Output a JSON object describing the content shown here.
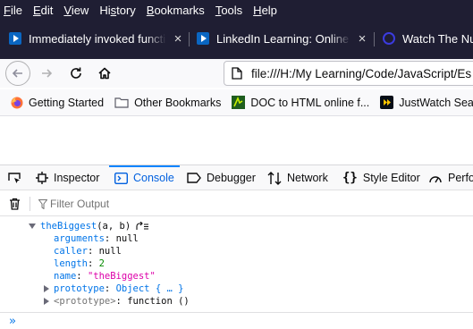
{
  "menubar": {
    "items": [
      {
        "accel": "F",
        "rest": "ile"
      },
      {
        "accel": "E",
        "rest": "dit"
      },
      {
        "accel": "V",
        "rest": "iew"
      },
      {
        "pre": "Hi",
        "accel": "s",
        "rest": "tory"
      },
      {
        "accel": "B",
        "rest": "ookmarks"
      },
      {
        "accel": "T",
        "rest": "ools"
      },
      {
        "accel": "H",
        "rest": "elp"
      }
    ]
  },
  "tabs": [
    {
      "title": "Immediately invoked function",
      "close": "×",
      "icon": "linkedin-learning-icon"
    },
    {
      "title": "LinkedIn Learning: Online Co",
      "close": "×",
      "icon": "linkedin-learning-icon"
    },
    {
      "title": "Watch The Nut",
      "icon": "justwatch-icon"
    }
  ],
  "navbar": {
    "url": "file:///H:/My Learning/Code/JavaScript/Es"
  },
  "bookmarks": [
    {
      "label": "Getting Started",
      "icon": "firefox-icon"
    },
    {
      "label": "Other Bookmarks",
      "icon": "folder-icon"
    },
    {
      "label": "DOC to HTML online f...",
      "icon": "doc-to-html-icon"
    },
    {
      "label": "JustWatch Search",
      "icon": "justwatch-icon"
    }
  ],
  "devtools": {
    "tabs": [
      {
        "label": "Inspector",
        "icon": "inspector-icon"
      },
      {
        "label": "Console",
        "icon": "console-icon",
        "selected": true
      },
      {
        "label": "Debugger",
        "icon": "debugger-icon"
      },
      {
        "label": "Network",
        "icon": "network-icon"
      },
      {
        "label": "Style Editor",
        "icon": "style-editor-icon"
      },
      {
        "label": "Perfo",
        "icon": "performance-icon"
      }
    ],
    "filter_placeholder": "Filter Output",
    "console": {
      "fn_name": "theBiggest",
      "fn_args": "(a, b)",
      "properties": [
        {
          "key": "arguments",
          "value": "null",
          "kind": "null"
        },
        {
          "key": "caller",
          "value": "null",
          "kind": "null"
        },
        {
          "key": "length",
          "value": "2",
          "kind": "num"
        },
        {
          "key": "name",
          "value": "\"theBiggest\"",
          "kind": "str"
        }
      ],
      "prototype_key": "prototype",
      "prototype_value": "Object { … }",
      "proto_key": "<prototype>",
      "proto_value": "function ()"
    },
    "prompt": "»"
  },
  "colors": {
    "chrome_dark": "#1f1e33",
    "accent": "#0a84ff",
    "console_key": "#0074e8",
    "string": "#dd00a9",
    "number": "#058b00"
  }
}
